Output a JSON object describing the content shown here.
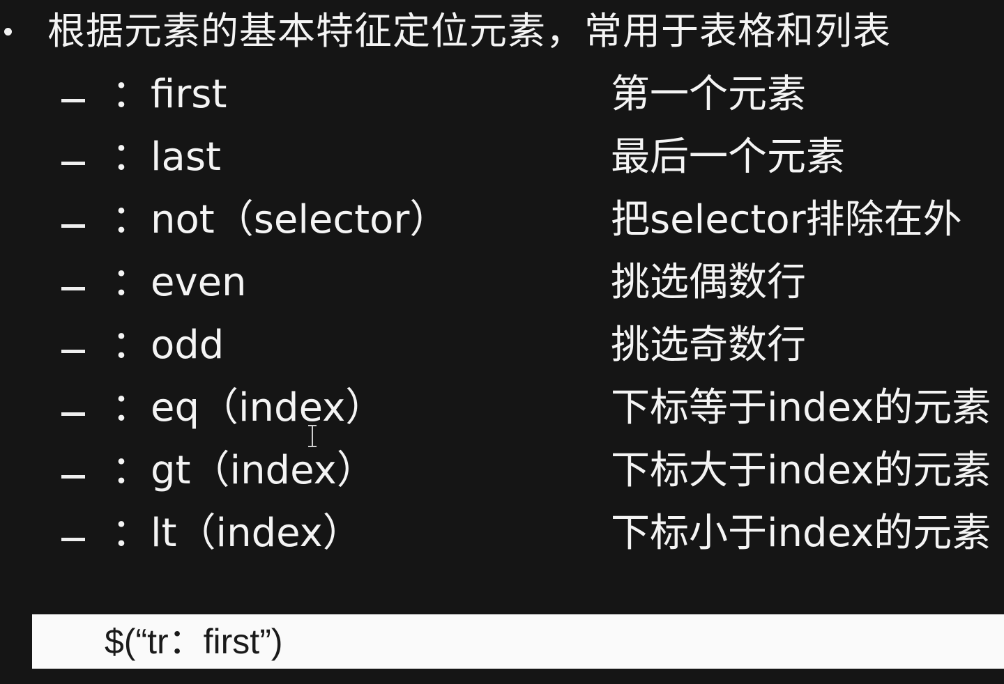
{
  "heading": "根据元素的基本特征定位元素，常用于表格和列表",
  "rows": [
    {
      "selector": "：first",
      "desc": "第一个元素"
    },
    {
      "selector": "：last",
      "desc": "最后一个元素"
    },
    {
      "selector": "：not（selector）",
      "desc": "把selector排除在外"
    },
    {
      "selector": "：even",
      "desc": "挑选偶数行"
    },
    {
      "selector": "：odd",
      "desc": "挑选奇数行"
    },
    {
      "selector": "：eq（index）",
      "desc": "下标等于index的元素"
    },
    {
      "selector": "：gt（index）",
      "desc": "下标大于index的元素"
    },
    {
      "selector": "：lt（index）",
      "desc": "下标小于index的元素"
    }
  ],
  "code_example": "$(“tr：first”)"
}
